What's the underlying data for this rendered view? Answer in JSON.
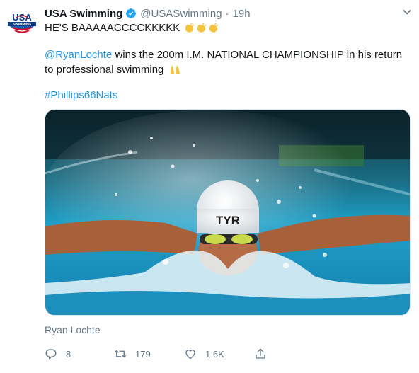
{
  "tweet": {
    "display_name": "USA Swimming",
    "handle": "@USASwimming",
    "separator": "·",
    "time": "19h",
    "line1": "HE'S BAAAAACCCCKKKKK",
    "mention": "@RyanLochte",
    "body_rest": " wins the 200m I.M. NATIONAL CHAMPIONSHIP in his return to professional swimming",
    "hashtag": "#Phillips66Nats",
    "caption": "Ryan Lochte",
    "logo_text_top": "USA",
    "logo_text_bottom": "SWIMMING",
    "cap_brand": "TYR"
  },
  "actions": {
    "reply_count": "8",
    "retweet_count": "179",
    "like_count": "1.6K"
  },
  "colors": {
    "link": "#1b95e0",
    "muted": "#657786",
    "verified": "#1da1f2",
    "water": "#1a9ec9"
  },
  "icons": [
    "verified-icon",
    "chevron-down-icon",
    "clap-icon",
    "raised-hands-icon",
    "reply-icon",
    "retweet-icon",
    "like-icon",
    "share-icon"
  ]
}
